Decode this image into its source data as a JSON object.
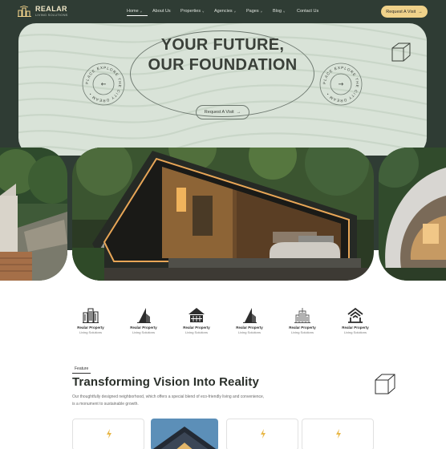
{
  "brand": {
    "name": "REALAR",
    "tagline": "LIVING SOLUTIONS"
  },
  "nav": [
    {
      "label": "Home",
      "caret": "˅",
      "active": true
    },
    {
      "label": "About Us",
      "caret": ""
    },
    {
      "label": "Properties",
      "caret": "˅"
    },
    {
      "label": "Agencies",
      "caret": "˅"
    },
    {
      "label": "Pages",
      "caret": "˅"
    },
    {
      "label": "Blog",
      "caret": "˅"
    },
    {
      "label": "Contact Us",
      "caret": ""
    }
  ],
  "header_button": {
    "label": "Request A Visit",
    "arrow": "→"
  },
  "hero": {
    "line1": "YOUR FUTURE,",
    "line2": "OUR FOUNDATION",
    "button_label": "Request A Visit",
    "button_arrow": "→",
    "badge_text": "PLACE EXPLORE THE CITY DREAM • ",
    "badge_arrow_left": "←",
    "badge_arrow_right": "→"
  },
  "partners": [
    {
      "name": "Realar Property",
      "tag": "Living Solutions",
      "icon": "city-towers-icon"
    },
    {
      "name": "Realar Property",
      "tag": "Living Solutions",
      "icon": "leaf-tower-icon"
    },
    {
      "name": "Realar Property",
      "tag": "Living Solutions",
      "icon": "house-grid-icon"
    },
    {
      "name": "Realar Property",
      "tag": "Living Solutions",
      "icon": "leaf-tower-icon"
    },
    {
      "name": "Realar Property",
      "tag": "Living Solutions",
      "icon": "skyscraper-icon"
    },
    {
      "name": "Realar Property",
      "tag": "Living Solutions",
      "icon": "roof-lines-icon"
    }
  ],
  "feature": {
    "tag": "Feature",
    "title": "Transforming Vision Into Reality",
    "description": "Our thoughtfully designed neighborhood, which offers a special blend of eco-friendly living and convenience, is a monument to sustainable growth."
  },
  "colors": {
    "dark_green": "#2f3c34",
    "hero_mint": "#d9e3d8",
    "accent_gold": "#f0d28a",
    "cream": "#f2e9c9"
  }
}
